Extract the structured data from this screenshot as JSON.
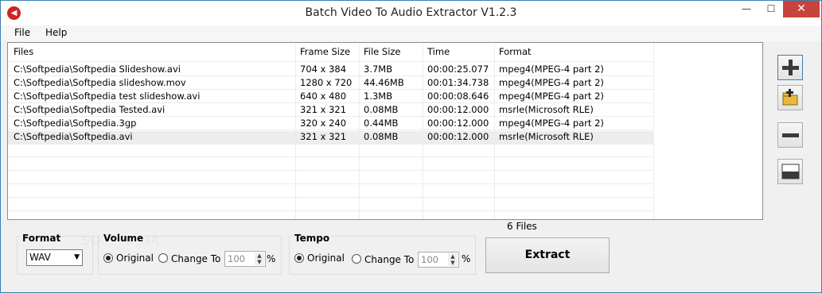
{
  "window": {
    "title": "Batch Video To Audio Extractor V1.2.3",
    "minimize_glyph": "—",
    "maximize_glyph": "☐",
    "close_glyph": "✕",
    "app_icon": "speaker-icon"
  },
  "menu": {
    "items": [
      {
        "label": "File"
      },
      {
        "label": "Help"
      }
    ]
  },
  "table": {
    "columns": [
      "Files",
      "Frame Size",
      "File Size",
      "Time",
      "Format"
    ],
    "rows": [
      [
        "C:\\Softpedia\\Softpedia Slideshow.avi",
        "704 x 384",
        "3.7MB",
        "00:00:25.077",
        "mpeg4(MPEG-4 part 2)"
      ],
      [
        "C:\\Softpedia\\Softpedia slideshow.mov",
        "1280 x 720",
        "44.46MB",
        "00:01:34.738",
        "mpeg4(MPEG-4 part 2)"
      ],
      [
        "C:\\Softpedia\\Softpedia test slideshow.avi",
        "640 x 480",
        "1.3MB",
        "00:00:08.646",
        "mpeg4(MPEG-4 part 2)"
      ],
      [
        "C:\\Softpedia\\Softpedia Tested.avi",
        "321 x 321",
        "0.08MB",
        "00:00:12.000",
        "msrle(Microsoft RLE)"
      ],
      [
        "C:\\Softpedia\\Softpedia.3gp",
        "320 x 240",
        "0.44MB",
        "00:00:12.000",
        "mpeg4(MPEG-4 part 2)"
      ],
      [
        "C:\\Softpedia\\Softpedia.avi",
        "321 x 321",
        "0.08MB",
        "00:00:12.000",
        "msrle(Microsoft RLE)"
      ]
    ],
    "selected_row": 5
  },
  "side_buttons": [
    {
      "icon": "add-file-icon"
    },
    {
      "icon": "add-folder-icon"
    },
    {
      "icon": "remove-icon"
    },
    {
      "icon": "clear-list-icon"
    }
  ],
  "file_count": "6 Files",
  "format": {
    "title": "Format",
    "value": "WAV"
  },
  "volume": {
    "title": "Volume",
    "original_label": "Original",
    "change_label": "Change To",
    "value": "100",
    "unit": "%",
    "selected": "original"
  },
  "tempo": {
    "title": "Tempo",
    "original_label": "Original",
    "change_label": "Change To",
    "value": "100",
    "unit": "%",
    "selected": "original"
  },
  "extract_label": "Extract",
  "watermark": "SOFTPEDIA",
  "colors": {
    "close": "#c7433b",
    "accent": "#3c7fb1",
    "app_icon": "#d42222"
  }
}
